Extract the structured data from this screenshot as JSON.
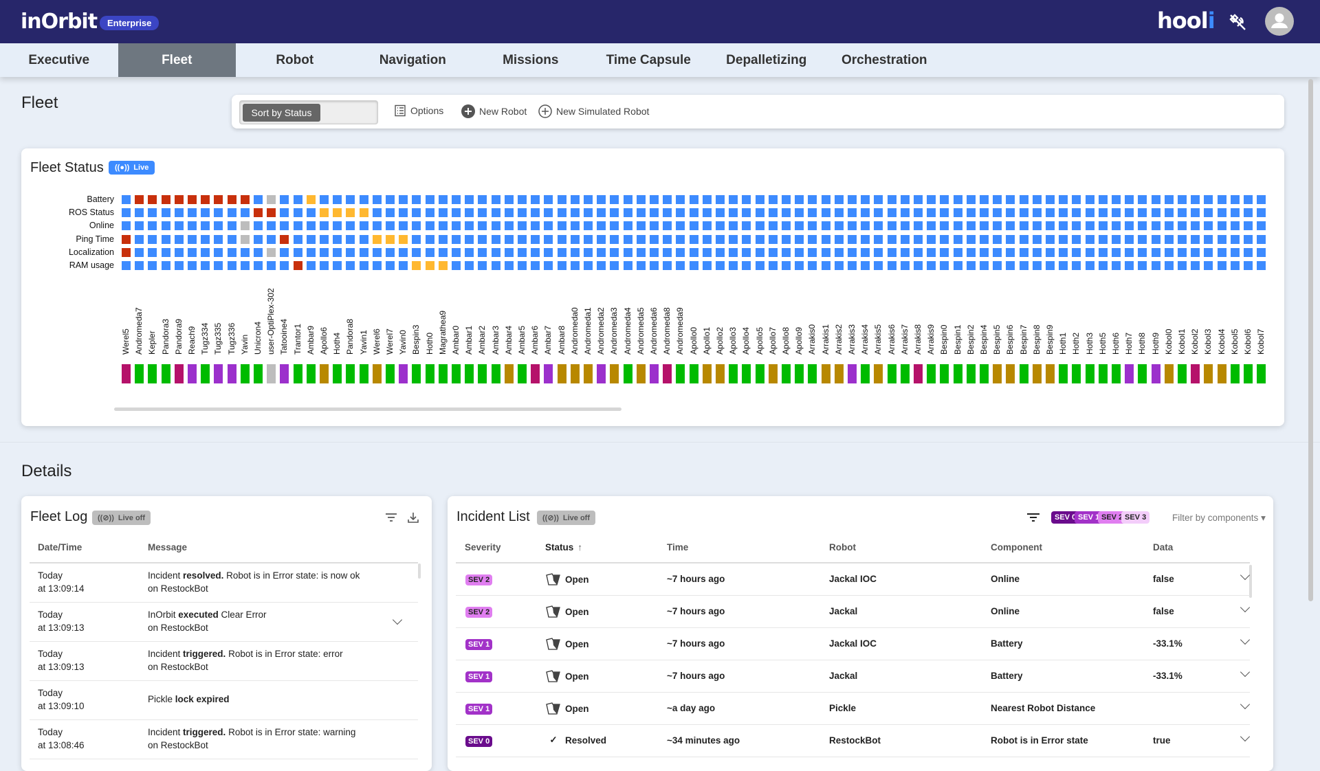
{
  "header": {
    "logo": "inOrbit",
    "edition": "Enterprise",
    "customer_logo": "hooli",
    "icons": [
      "satellite-off-icon",
      "user-avatar-icon"
    ]
  },
  "nav": {
    "tabs": [
      "Executive",
      "Fleet",
      "Robot",
      "Navigation",
      "Missions",
      "Time Capsule",
      "Depalletizing",
      "Orchestration"
    ],
    "active": "Fleet"
  },
  "page": {
    "title": "Fleet"
  },
  "toolbar": {
    "sort_label": "Sort by Status",
    "options_label": "Options",
    "new_robot_label": "New Robot",
    "new_sim_label": "New Simulated Robot"
  },
  "fleet_status": {
    "title": "Fleet Status",
    "live_label": "Live",
    "colors": {
      "ok": "#3d8bff",
      "error": "#c8300c",
      "warning": "#ffb830",
      "unknown": "#bdbdbd"
    },
    "status_colors": {
      "magenta": "#b5126a",
      "green": "#00bb00",
      "grey": "#bdbdbd",
      "violet": "#9c30cc",
      "ochre": "#b88800"
    },
    "robots": [
      [
        "Werel5",
        "magenta"
      ],
      [
        "Andromeda7",
        "green"
      ],
      [
        "Kepler",
        "green"
      ],
      [
        "Pandora3",
        "green"
      ],
      [
        "Pandora9",
        "magenta"
      ],
      [
        "Reach9",
        "violet"
      ],
      [
        "Tugz334",
        "green"
      ],
      [
        "Tugz335",
        "violet"
      ],
      [
        "Tugz336",
        "violet"
      ],
      [
        "Yavin",
        "green"
      ],
      [
        "Unicron4",
        "green"
      ],
      [
        "user-OptiPlex-302",
        "grey"
      ],
      [
        "Tatooine4",
        "violet"
      ],
      [
        "Trantor1",
        "green"
      ],
      [
        "Ambar9",
        "green"
      ],
      [
        "Apollo6",
        "ochre"
      ],
      [
        "Hoth4",
        "green"
      ],
      [
        "Pandora8",
        "green"
      ],
      [
        "Yavin1",
        "green"
      ],
      [
        "Werel6",
        "ochre"
      ],
      [
        "Werel7",
        "green"
      ],
      [
        "Yavin0",
        "violet"
      ],
      [
        "Bespin3",
        "green"
      ],
      [
        "Hoth0",
        "green"
      ],
      [
        "Magratheа9",
        "green"
      ],
      [
        "Ambar0",
        "green"
      ],
      [
        "Ambar1",
        "green"
      ],
      [
        "Ambar2",
        "green"
      ],
      [
        "Ambar3",
        "green"
      ],
      [
        "Ambar4",
        "ochre"
      ],
      [
        "Ambar5",
        "green"
      ],
      [
        "Ambar6",
        "magenta"
      ],
      [
        "Ambar7",
        "violet"
      ],
      [
        "Ambar8",
        "ochre"
      ],
      [
        "Andromeda0",
        "ochre"
      ],
      [
        "Andromeda1",
        "ochre"
      ],
      [
        "Andromeda2",
        "violet"
      ],
      [
        "Andromeda3",
        "ochre"
      ],
      [
        "Andromeda4",
        "green"
      ],
      [
        "Andromeda5",
        "ochre"
      ],
      [
        "Andromeda6",
        "violet"
      ],
      [
        "Andromeda8",
        "magenta"
      ],
      [
        "Andromeda9",
        "green"
      ],
      [
        "Apollo0",
        "green"
      ],
      [
        "Apollo1",
        "ochre"
      ],
      [
        "Apollo2",
        "ochre"
      ],
      [
        "Apollo3",
        "green"
      ],
      [
        "Apollo4",
        "green"
      ],
      [
        "Apollo5",
        "green"
      ],
      [
        "Apollo7",
        "ochre"
      ],
      [
        "Apollo8",
        "green"
      ],
      [
        "Apollo9",
        "green"
      ],
      [
        "Arrakis0",
        "green"
      ],
      [
        "Arrakis1",
        "ochre"
      ],
      [
        "Arrakis2",
        "ochre"
      ],
      [
        "Arrakis3",
        "violet"
      ],
      [
        "Arrakis4",
        "green"
      ],
      [
        "Arrakis5",
        "ochre"
      ],
      [
        "Arrakis6",
        "green"
      ],
      [
        "Arrakis7",
        "green"
      ],
      [
        "Arrakis8",
        "magenta"
      ],
      [
        "Arrakis9",
        "green"
      ],
      [
        "Bespin0",
        "green"
      ],
      [
        "Bespin1",
        "green"
      ],
      [
        "Bespin2",
        "green"
      ],
      [
        "Bespin4",
        "green"
      ],
      [
        "Bespin5",
        "ochre"
      ],
      [
        "Bespin6",
        "ochre"
      ],
      [
        "Bespin7",
        "green"
      ],
      [
        "Bespin8",
        "ochre"
      ],
      [
        "Bespin9",
        "ochre"
      ],
      [
        "Hoth1",
        "green"
      ],
      [
        "Hoth2",
        "green"
      ],
      [
        "Hoth3",
        "green"
      ],
      [
        "Hoth5",
        "green"
      ],
      [
        "Hoth6",
        "green"
      ],
      [
        "Hoth7",
        "violet"
      ],
      [
        "Hoth8",
        "green"
      ],
      [
        "Hoth9",
        "violet"
      ],
      [
        "Kobol0",
        "ochre"
      ],
      [
        "Kobol1",
        "green"
      ],
      [
        "Kobol2",
        "magenta"
      ],
      [
        "Kobol3",
        "ochre"
      ],
      [
        "Kobol4",
        "ochre"
      ],
      [
        "Kobol5",
        "green"
      ],
      [
        "Kobol6",
        "green"
      ],
      [
        "Kobol7",
        "green"
      ]
    ],
    "metrics": [
      {
        "label": "Battery",
        "default": "ok",
        "exceptions": {
          "Andromeda7": "error",
          "Kepler": "error",
          "Pandora3": "error",
          "Pandora9": "error",
          "Reach9": "error",
          "Tugz334": "error",
          "Tugz335": "error",
          "Tugz336": "error",
          "Yavin": "error",
          "user-OptiPlex-302": "unknown",
          "Ambar9": "warning"
        }
      },
      {
        "label": "ROS Status",
        "default": "ok",
        "exceptions": {
          "Unicron4": "error",
          "user-OptiPlex-302": "error",
          "Apollo6": "warning",
          "Hoth4": "warning",
          "Pandora8": "warning",
          "Yavin1": "warning"
        }
      },
      {
        "label": "Online",
        "default": "ok",
        "exceptions": {
          "Yavin": "unknown"
        }
      },
      {
        "label": "Ping Time",
        "default": "ok",
        "exceptions": {
          "Werel5": "error",
          "Yavin": "unknown",
          "Tatooine4": "error",
          "Werel6": "warning",
          "Werel7": "warning",
          "Yavin0": "warning"
        }
      },
      {
        "label": "Localization",
        "default": "ok",
        "exceptions": {
          "Werel5": "error",
          "user-OptiPlex-302": "unknown"
        }
      },
      {
        "label": "RAM usage",
        "default": "ok",
        "exceptions": {
          "Trantor1": "error",
          "Bespin3": "warning",
          "Hoth0": "warning",
          "Magratheа9": "warning"
        }
      }
    ]
  },
  "details": {
    "title": "Details"
  },
  "fleet_log": {
    "title": "Fleet Log",
    "live_label": "Live off",
    "columns": [
      "Date/Time",
      "Message"
    ],
    "rows": [
      {
        "date": "Today",
        "time": "at 13:09:14",
        "pre": "Incident ",
        "bold": "resolved.",
        "post": " Robot is in Error state: is now ok",
        "line2": "on RestockBot",
        "expand": false
      },
      {
        "date": "Today",
        "time": "at 13:09:13",
        "pre": "InOrbit ",
        "bold": "executed",
        "post": " Clear Error",
        "line2": "on RestockBot",
        "expand": true
      },
      {
        "date": "Today",
        "time": "at 13:09:13",
        "pre": "Incident ",
        "bold": "triggered.",
        "post": " Robot is in Error state: error",
        "line2": "on RestockBot",
        "expand": false
      },
      {
        "date": "Today",
        "time": "at 13:09:10",
        "pre": "Pickle ",
        "bold": "lock expired",
        "post": "",
        "line2": "",
        "expand": false
      },
      {
        "date": "Today",
        "time": "at 13:08:46",
        "pre": "Incident ",
        "bold": "triggered.",
        "post": " Robot is in Error state: warning",
        "line2": "on RestockBot",
        "expand": false
      }
    ]
  },
  "incidents": {
    "title": "Incident List",
    "live_label": "Live off",
    "sev_filters": [
      {
        "label": "SEV 0",
        "color": "#6a0c8c",
        "text": "#fff"
      },
      {
        "label": "SEV 1",
        "color": "#a232c8",
        "text": "#fff"
      },
      {
        "label": "SEV 2",
        "color": "#e07ef0",
        "text": "#222"
      },
      {
        "label": "SEV 3",
        "color": "#f3cdfa",
        "text": "#222"
      }
    ],
    "filter_components": "Filter by components",
    "columns": [
      "Severity",
      "Status",
      "Time",
      "Robot",
      "Component",
      "Data"
    ],
    "sort_indicator": "↑",
    "rows": [
      {
        "sev": "SEV 2",
        "status": "Open",
        "time": "~7 hours ago",
        "robot": "Jackal IOC",
        "component": "Online",
        "data": "false"
      },
      {
        "sev": "SEV 2",
        "status": "Open",
        "time": "~7 hours ago",
        "robot": "Jackal",
        "component": "Online",
        "data": "false"
      },
      {
        "sev": "SEV 1",
        "status": "Open",
        "time": "~7 hours ago",
        "robot": "Jackal IOC",
        "component": "Battery",
        "data": "-33.1%"
      },
      {
        "sev": "SEV 1",
        "status": "Open",
        "time": "~7 hours ago",
        "robot": "Jackal",
        "component": "Battery",
        "data": "-33.1%"
      },
      {
        "sev": "SEV 1",
        "status": "Open",
        "time": "~a day ago",
        "robot": "Pickle",
        "component": "Nearest Robot Distance",
        "data": ""
      },
      {
        "sev": "SEV 0",
        "status": "Resolved",
        "time": "~34 minutes ago",
        "robot": "RestockBot",
        "component": "Robot is in Error state",
        "data": "true"
      }
    ]
  }
}
